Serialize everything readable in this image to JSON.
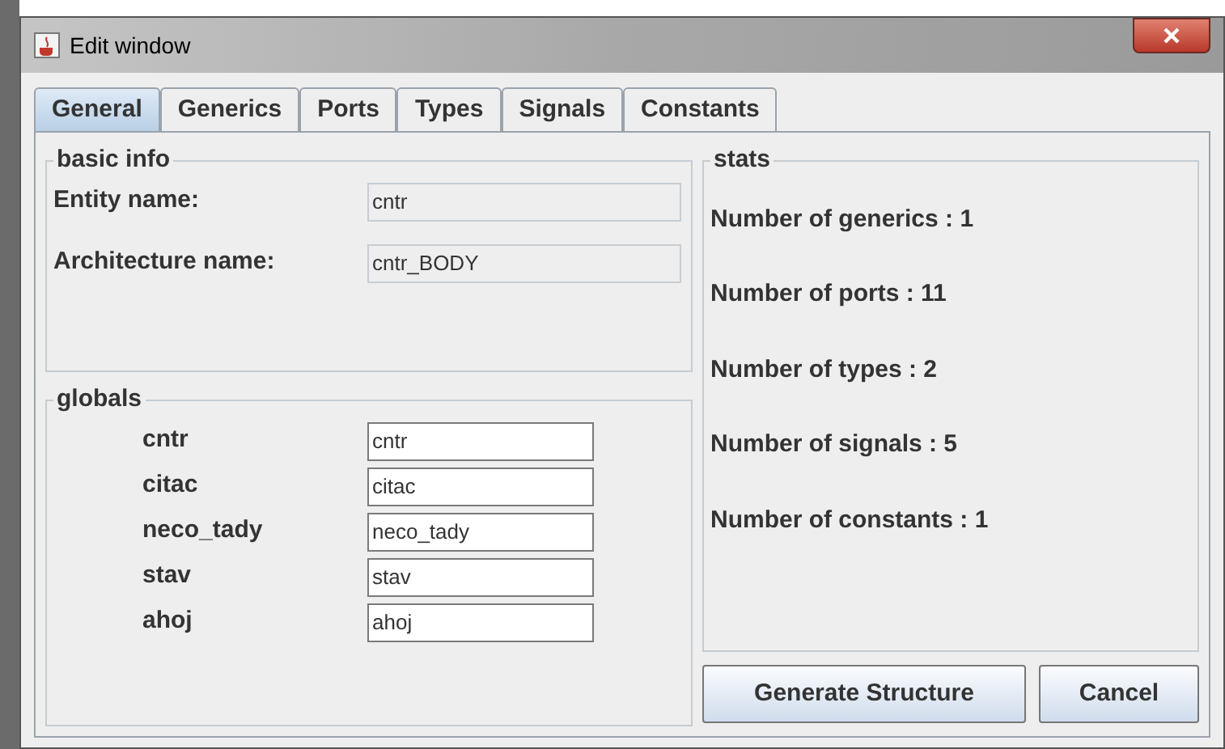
{
  "window": {
    "title": "Edit window"
  },
  "tabs": [
    {
      "label": "General",
      "selected": true
    },
    {
      "label": "Generics",
      "selected": false
    },
    {
      "label": "Ports",
      "selected": false
    },
    {
      "label": "Types",
      "selected": false
    },
    {
      "label": "Signals",
      "selected": false
    },
    {
      "label": "Constants",
      "selected": false
    }
  ],
  "basic_info": {
    "title": "basic info",
    "fields": [
      {
        "label": "Entity name:",
        "value": "cntr",
        "editable": false
      },
      {
        "label": "Architecture name:",
        "value": "cntr_BODY",
        "editable": false
      }
    ]
  },
  "globals": {
    "title": "globals",
    "fields": [
      {
        "label": "cntr",
        "value": "cntr",
        "editable": true
      },
      {
        "label": "citac",
        "value": "citac",
        "editable": true
      },
      {
        "label": "neco_tady",
        "value": "neco_tady",
        "editable": true
      },
      {
        "label": "stav",
        "value": "stav",
        "editable": true
      },
      {
        "label": "ahoj",
        "value": "ahoj",
        "editable": true
      }
    ]
  },
  "stats": {
    "title": "stats",
    "lines": [
      "Number of generics : 1",
      "Number of ports : 11",
      "Number of types : 2",
      "Number of signals : 5",
      "Number of constants : 1"
    ]
  },
  "buttons": [
    "Generate Structure",
    "Cancel"
  ]
}
